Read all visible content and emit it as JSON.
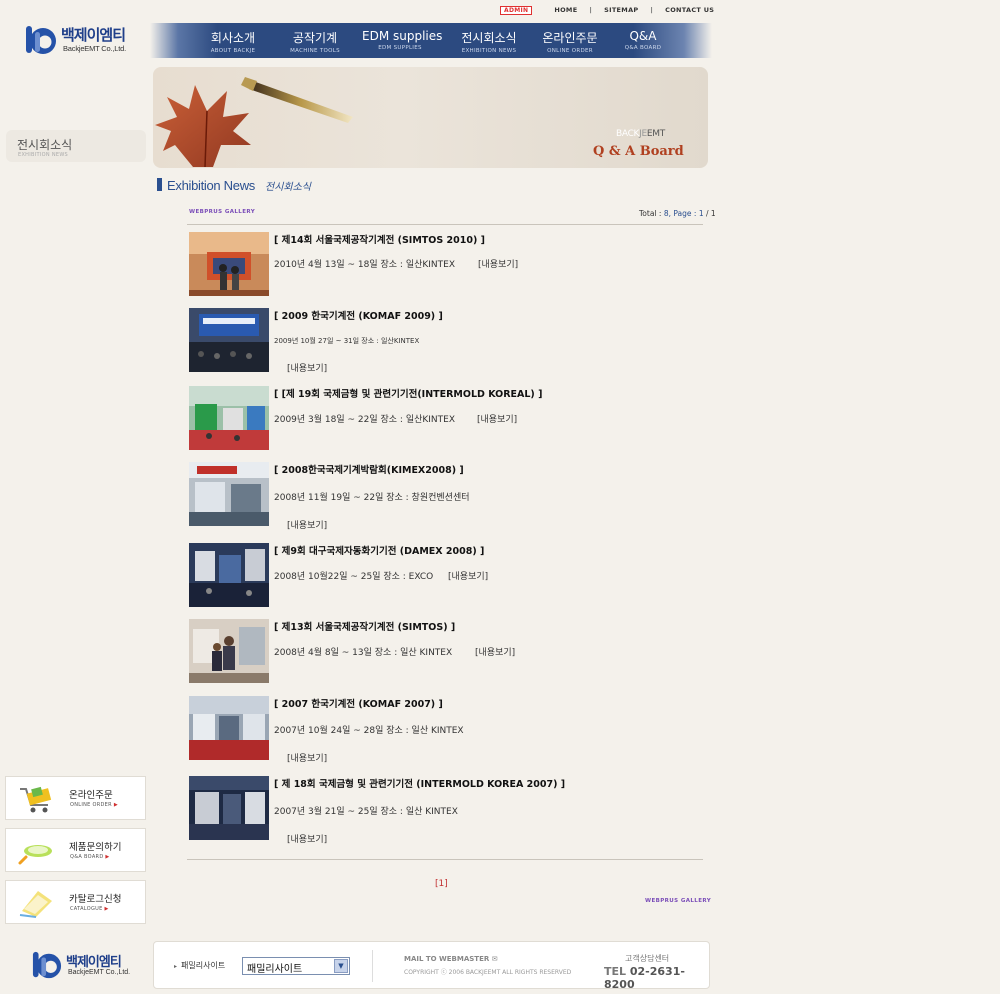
{
  "util_links": {
    "admin": "ADMIN",
    "home": "HOME",
    "sitemap": "SITEMAP",
    "contact": "CONTACT US"
  },
  "logo": {
    "kr": "백제이엠티",
    "en": "BackjeEMT Co.,Ltd."
  },
  "nav": [
    {
      "kr": "회사소개",
      "en": "ABOUT BACKJE"
    },
    {
      "kr": "공작기계",
      "en": "MACHINE TOOLS"
    },
    {
      "kr": "EDM supplies",
      "en": "EDM SUPPLIES"
    },
    {
      "kr": "전시회소식",
      "en": "EXHIBITION NEWS"
    },
    {
      "kr": "온라인주문",
      "en": "ONLINE ORDER"
    },
    {
      "kr": "Q&A",
      "en": "Q&A BOARD"
    }
  ],
  "banner": {
    "brand_light": "BACK",
    "brand_mid": "JE",
    "brand_dark": "EMT",
    "title": "Q & A Board"
  },
  "section": {
    "kr": "전시회소식",
    "en": "EXHIBITION NEWS"
  },
  "page_title": {
    "en": "Exhibition News",
    "kr": "전시회소식"
  },
  "gallery_label": "WEBPRUS GALLERY",
  "total": {
    "label": "Total : ",
    "count": "8",
    "page_label": ", Page : ",
    "page": "1",
    "pages": "/ 1"
  },
  "items": [
    {
      "title": "[ 제14회 서울국제공작기계전 (SIMTOS 2010) ]",
      "info": "2010년 4월 13일 ~ 18일 장소 : 일산KINTEX",
      "more": "[내용보기]"
    },
    {
      "title": "[ 2009 한국기계전 (KOMAF 2009) ]",
      "info": "2009년 10월 27일 ~ 31일  장소 : 일산KINTEX",
      "more": "[내용보기]"
    },
    {
      "title": "[ [제 19회 국제금형 및 관련기기전(INTERMOLD KOREAL) ]",
      "info": "2009년 3월 18일 ~ 22일 장소 : 일산KINTEX",
      "more": "[내용보기]"
    },
    {
      "title": "[ 2008한국국제기계박람회(KIMEX2008) ]",
      "info": "2008년 11월 19일 ~ 22일 장소 : 창원컨벤션센터",
      "more": "[내용보기]"
    },
    {
      "title": "[ 제9회 대구국제자동화기기전 (DAMEX 2008) ]",
      "info": "2008년 10월22일 ~ 25일 장소 : EXCO",
      "more": "[내용보기]"
    },
    {
      "title": "[ 제13회 서울국제공작기계전 (SIMTOS) ]",
      "info": "2008년 4월 8일 ~ 13일 장소 : 일산 KINTEX",
      "more": "[내용보기]"
    },
    {
      "title": "[ 2007 한국기계전 (KOMAF 2007) ]",
      "info": "2007년 10월 24일 ~ 28일 장소 : 일산 KINTEX",
      "more": "[내용보기]"
    },
    {
      "title": "[ 제 18회 국제금형 및 관련기기전 (INTERMOLD KOREA 2007) ]",
      "info": "2007년 3월 21일 ~ 25일  장소 : 일산 KINTEX",
      "more": "[내용보기]"
    }
  ],
  "pagination": "[1]",
  "quick": [
    {
      "kr": "온라인주문",
      "en": "ONLINE ORDER",
      "icon": "cart-icon"
    },
    {
      "kr": "제품문의하기",
      "en": "Q&A BOARD",
      "icon": "magnifier-icon"
    },
    {
      "kr": "카탈로그신청",
      "en": "CATALOGUE",
      "icon": "catalogue-icon"
    }
  ],
  "footer": {
    "family_label": "패밀리사이트",
    "family_selected": "패밀리사이트",
    "mail": "MAIL TO WEBMASTER",
    "copyright": "COPYRIGHT ⓒ 2006 BACKJEEMT ALL RIGHTS RESERVED",
    "cs_label": "고객상담센터",
    "tel_label": "TEL",
    "tel": "02-2631-8200"
  },
  "colors": {
    "nav": "#2c4a80",
    "accent": "#2a4f8f",
    "bg": "#f4f1eb",
    "pager": "#c03030",
    "gallery": "#7a4db8"
  }
}
